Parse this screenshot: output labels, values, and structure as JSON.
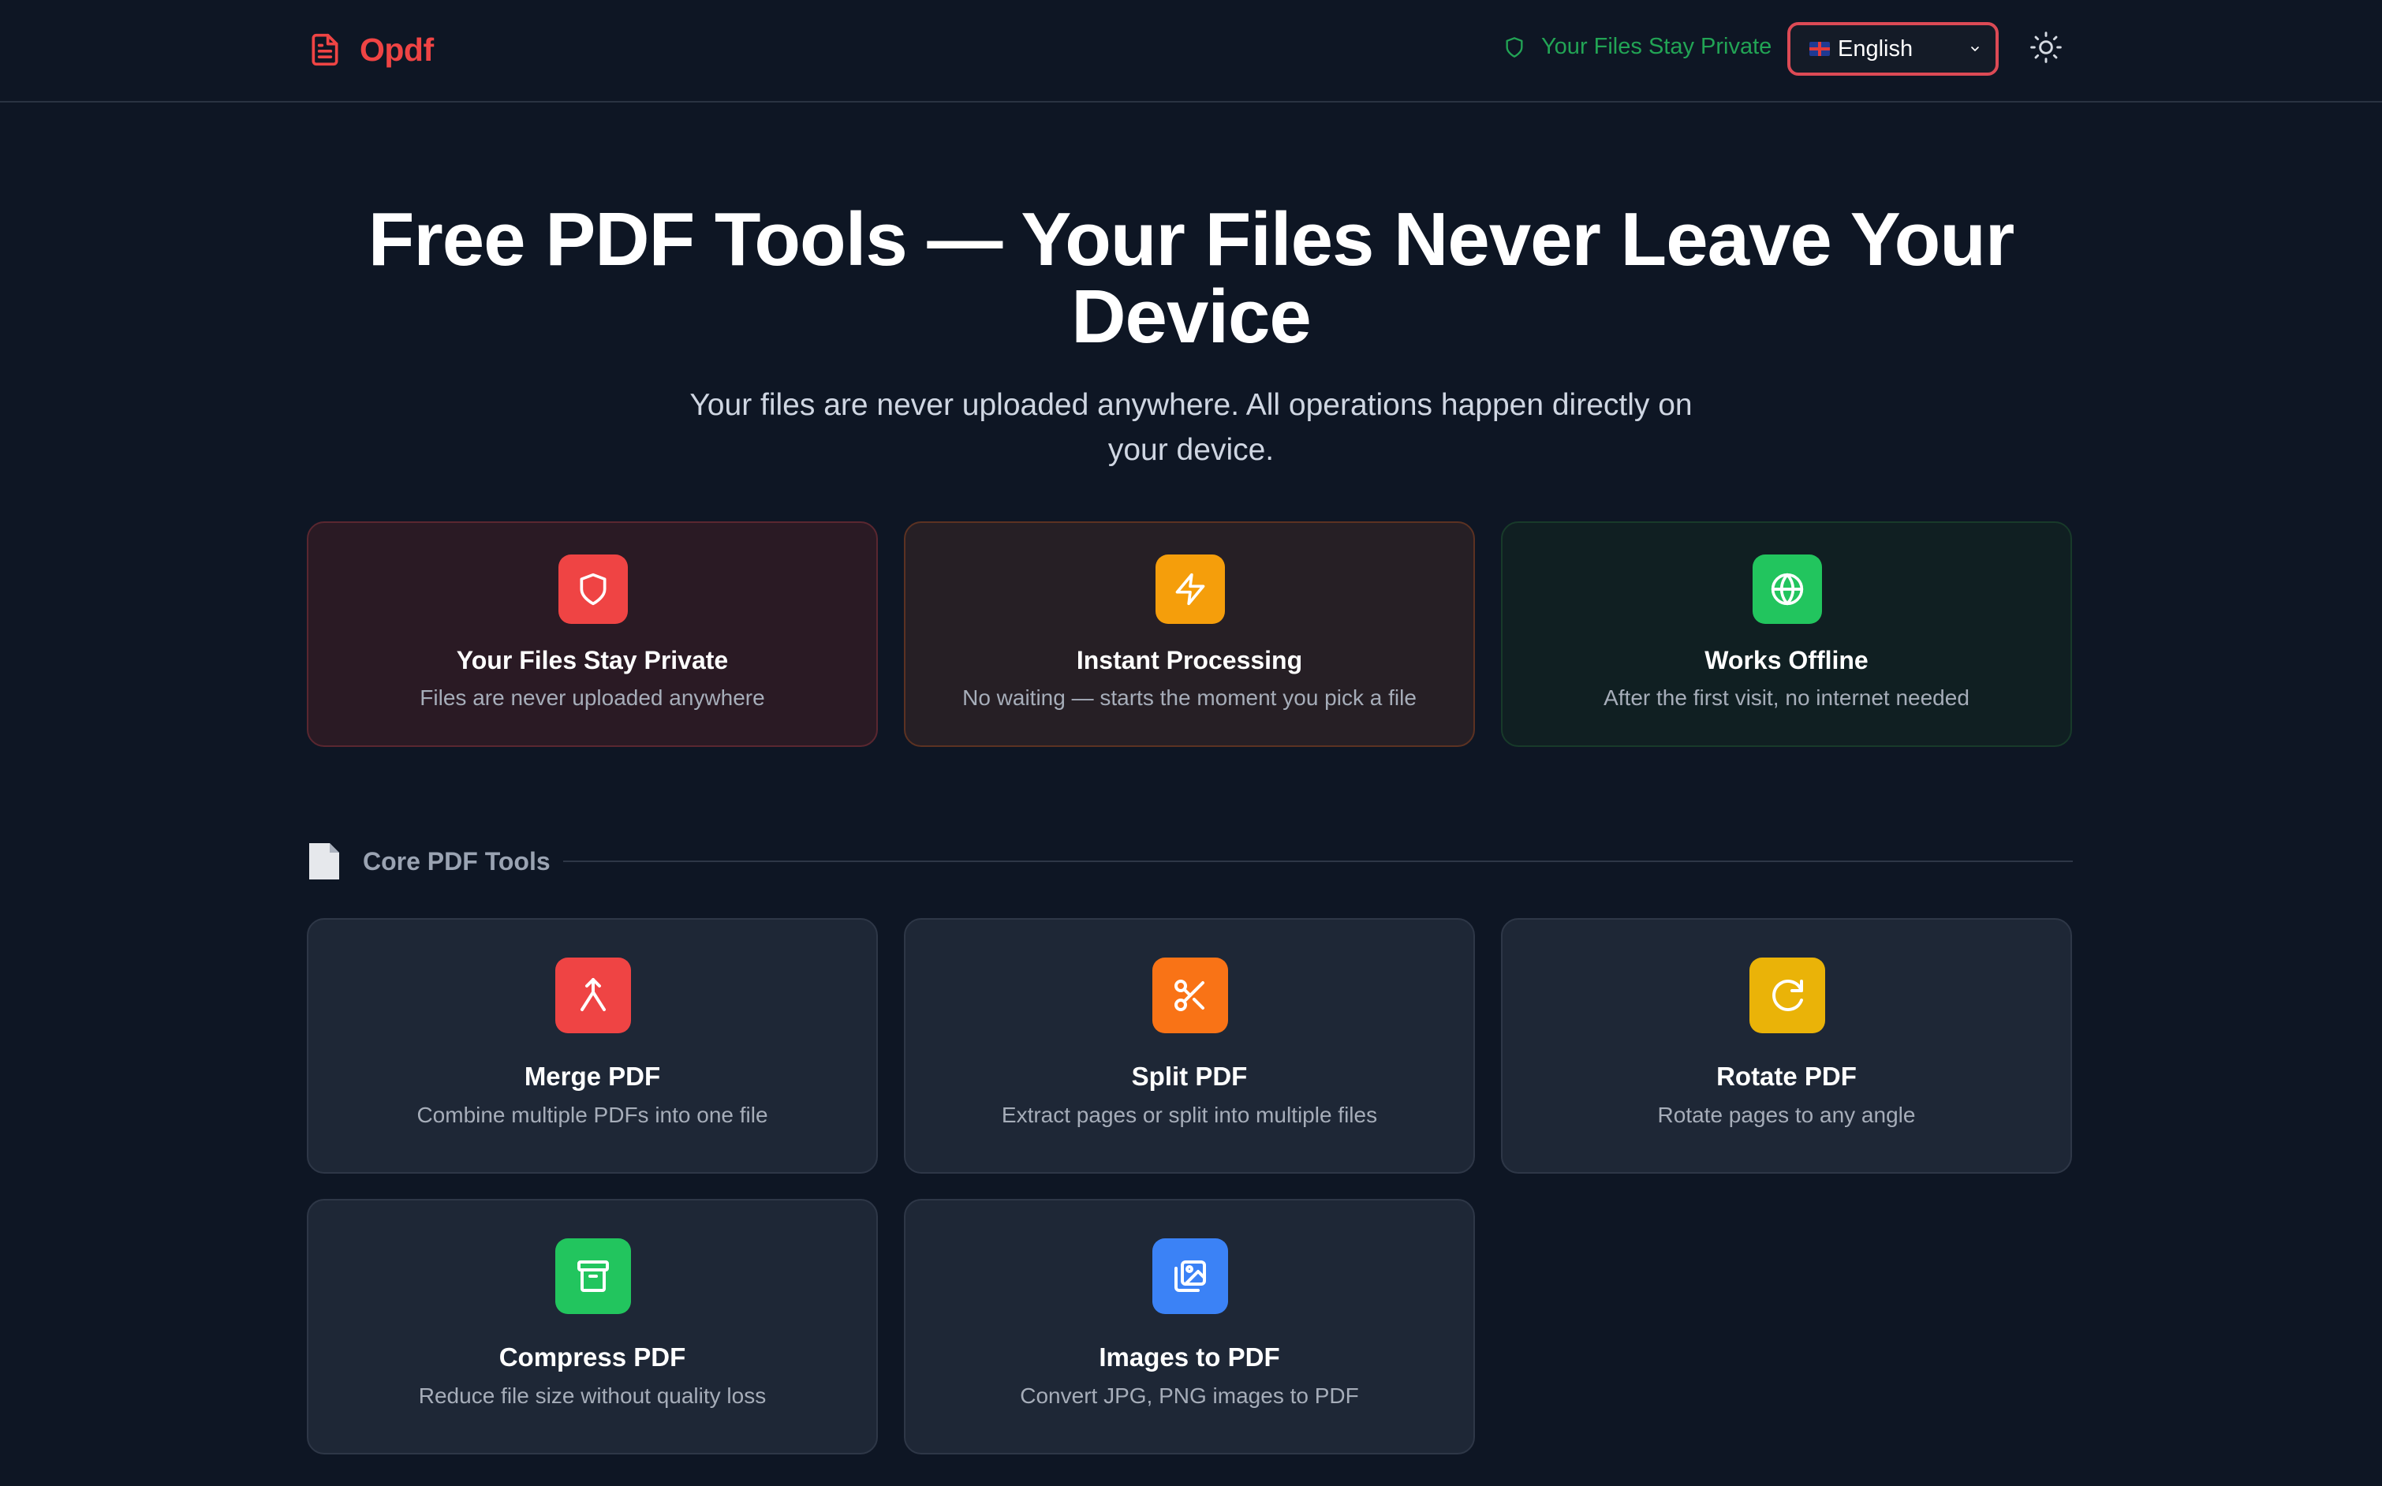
{
  "header": {
    "logo_text": "Opdf",
    "privacy_note": "Your Files Stay Private",
    "language": {
      "selected": "English",
      "flag": "uk-flag"
    }
  },
  "hero": {
    "title_line1": "Free PDF Tools — Your Files Never Leave Your",
    "title_line2": "Device",
    "subtitle_line1": "Your files are never uploaded anywhere. All operations happen directly on",
    "subtitle_line2": "your device."
  },
  "features": [
    {
      "title": "Your Files Stay Private",
      "desc": "Files are never uploaded anywhere",
      "icon": "shield-icon",
      "color": "#ef4444"
    },
    {
      "title": "Instant Processing",
      "desc": "No waiting — starts the moment you pick a file",
      "icon": "lightning-icon",
      "color": "#f59e0b"
    },
    {
      "title": "Works Offline",
      "desc": "After the first visit, no internet needed",
      "icon": "globe-icon",
      "color": "#22c55e"
    }
  ],
  "section": {
    "title": "Core PDF Tools",
    "icon": "document-icon"
  },
  "tools": [
    {
      "title": "Merge PDF",
      "desc": "Combine multiple PDFs into one file",
      "icon": "merge-icon",
      "color": "#ef4444"
    },
    {
      "title": "Split PDF",
      "desc": "Extract pages or split into multiple files",
      "icon": "scissors-icon",
      "color": "#f97316"
    },
    {
      "title": "Rotate PDF",
      "desc": "Rotate pages to any angle",
      "icon": "rotate-icon",
      "color": "#eab308"
    },
    {
      "title": "Compress PDF",
      "desc": "Reduce file size without quality loss",
      "icon": "archive-icon",
      "color": "#22c55e"
    },
    {
      "title": "Images to PDF",
      "desc": "Convert JPG, PNG images to PDF",
      "icon": "images-icon",
      "color": "#3b82f6"
    }
  ]
}
